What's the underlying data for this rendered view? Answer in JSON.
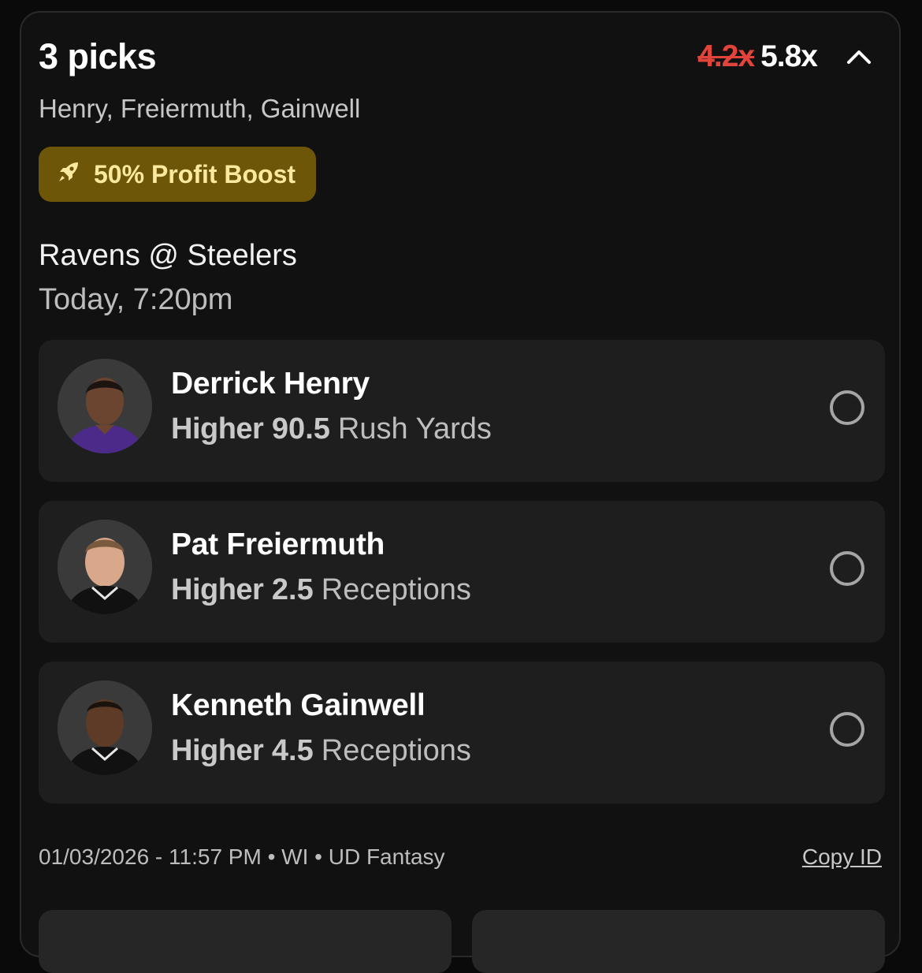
{
  "header": {
    "title": "3 picks",
    "multiplier_old": "4.2x",
    "multiplier_new": "5.8x",
    "toggle_icon": "chevron-up-icon"
  },
  "subtitle": "Henry, Freiermuth, Gainwell",
  "boost": {
    "icon": "rocket-icon",
    "label": "50% Profit Boost",
    "color": "#6e5608"
  },
  "game": {
    "matchup": "Ravens @ Steelers",
    "time": "Today, 7:20pm"
  },
  "picks": [
    {
      "name": "Derrick Henry",
      "direction": "Higher",
      "line": "90.5",
      "stat": "Rush Yards",
      "jersey": "#4b2a8a"
    },
    {
      "name": "Pat Freiermuth",
      "direction": "Higher",
      "line": "2.5",
      "stat": "Receptions",
      "jersey": "#111111"
    },
    {
      "name": "Kenneth Gainwell",
      "direction": "Higher",
      "line": "4.5",
      "stat": "Receptions",
      "jersey": "#111111"
    }
  ],
  "footer": {
    "meta": "01/03/2026 - 11:57 PM • WI • UD Fantasy",
    "copy_id": "Copy ID"
  },
  "colors": {
    "accent_red": "#e0443a",
    "boost_text": "#fbe9a0"
  }
}
